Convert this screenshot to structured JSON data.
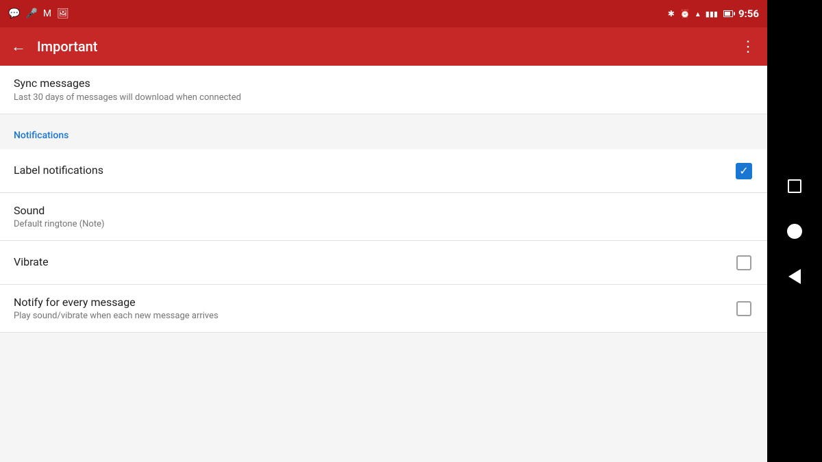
{
  "statusBar": {
    "time": "9:56",
    "icons": [
      "message",
      "tune",
      "gmail",
      "image"
    ]
  },
  "appBar": {
    "title": "Important",
    "backLabel": "←",
    "moreLabel": "⋮"
  },
  "syncMessages": {
    "title": "Sync messages",
    "subtitle": "Last 30 days of messages will download when connected"
  },
  "notificationsSection": {
    "header": "Notifications"
  },
  "settings": [
    {
      "id": "label-notifications",
      "title": "Label notifications",
      "subtitle": "",
      "hasCheckbox": true,
      "checked": true
    },
    {
      "id": "sound",
      "title": "Sound",
      "subtitle": "Default ringtone (Note)",
      "hasCheckbox": false,
      "checked": false
    },
    {
      "id": "vibrate",
      "title": "Vibrate",
      "subtitle": "",
      "hasCheckbox": true,
      "checked": false
    },
    {
      "id": "notify-every-message",
      "title": "Notify for every message",
      "subtitle": "Play sound/vibrate when each new message arrives",
      "hasCheckbox": true,
      "checked": false
    }
  ],
  "navBar": {
    "squareLabel": "Recent apps",
    "circleLabel": "Home",
    "triangleLabel": "Back"
  }
}
